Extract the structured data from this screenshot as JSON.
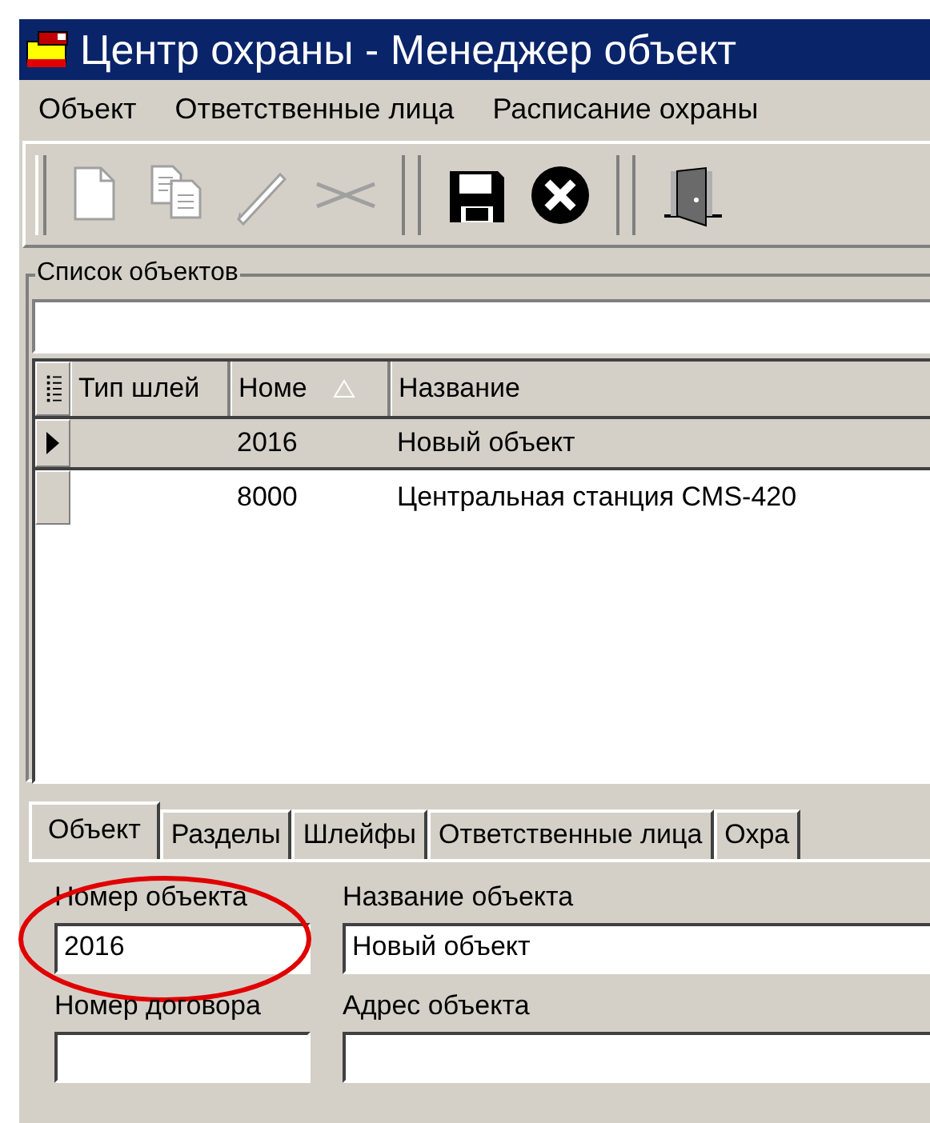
{
  "window": {
    "title": "Центр охраны - Менеджер объект"
  },
  "menu": [
    "Объект",
    "Ответственные лица",
    "Расписание охраны"
  ],
  "toolbar": [
    {
      "kind": "new",
      "disabled": true
    },
    {
      "kind": "copy",
      "disabled": true
    },
    {
      "kind": "edit",
      "disabled": true
    },
    {
      "kind": "cut",
      "disabled": true
    },
    {
      "kind": "separator"
    },
    {
      "kind": "save",
      "disabled": false
    },
    {
      "kind": "cancel",
      "disabled": false
    },
    {
      "kind": "separator"
    },
    {
      "kind": "exit",
      "disabled": false
    }
  ],
  "object_list": {
    "title": "Список объектов",
    "columns": [
      {
        "label": "Тип шлей",
        "sorted": false
      },
      {
        "label": "Номе",
        "sorted": true
      },
      {
        "label": "Название",
        "sorted": false
      }
    ],
    "rows": [
      {
        "selected": true,
        "number": "2016",
        "name": "Новый объект"
      },
      {
        "selected": false,
        "number": "8000",
        "name": "Центральная станция CMS-420"
      }
    ]
  },
  "tabs": [
    {
      "label": "Объект",
      "selected": true
    },
    {
      "label": "Разделы",
      "selected": false
    },
    {
      "label": "Шлейфы",
      "selected": false
    },
    {
      "label": "Ответственные лица",
      "selected": false
    },
    {
      "label": "Охра",
      "selected": false
    }
  ],
  "form": {
    "fields": [
      {
        "label": "Номер объекта",
        "value": "2016",
        "highlighted": true
      },
      {
        "label": "Название объекта",
        "value": "Новый объект",
        "highlighted": false
      },
      {
        "label": "Номер договора",
        "highlighted": false
      },
      {
        "label": "Адрес объекта",
        "highlighted": false
      }
    ]
  }
}
